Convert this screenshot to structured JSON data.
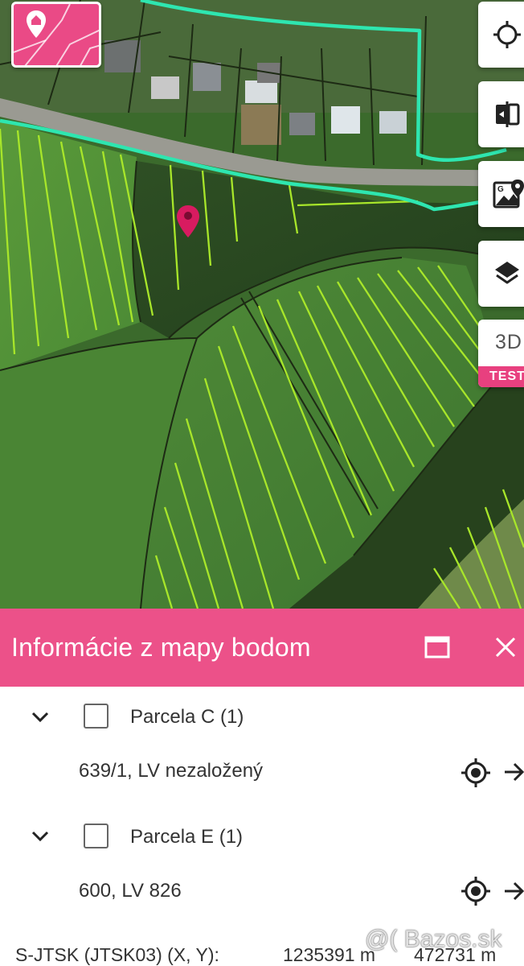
{
  "panel": {
    "title": "Informácie z mapy bodom",
    "groups": [
      {
        "label": "Parcela C (1)",
        "item": "639/1, LV nezaložený"
      },
      {
        "label": "Parcela E (1)",
        "item": "600, LV 826"
      }
    ],
    "coords": {
      "label": "S-JTSK (JTSK03) (X, Y):",
      "x": "1235391 m",
      "y": "472731 m"
    }
  },
  "map_controls": {
    "btn_3d": "3D",
    "test_badge": "TEST"
  },
  "watermark": "@( Bazos.sk",
  "colors": {
    "accent": "#ec5189",
    "parcel_lines": "#a8e62a",
    "boundary_line": "#2ee6b0",
    "pin": "#d81b60"
  }
}
